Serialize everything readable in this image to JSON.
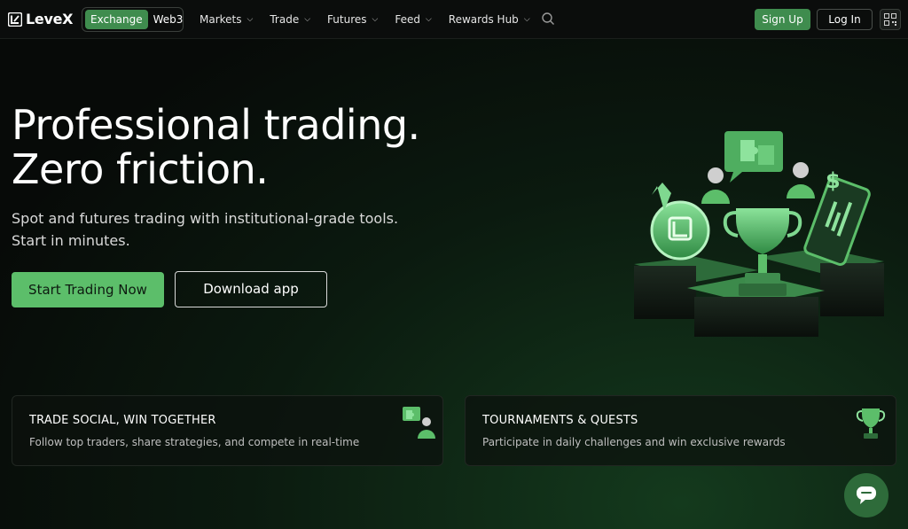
{
  "brand": {
    "name": "LeveX"
  },
  "mode_switch": {
    "options": [
      "Exchange",
      "Web3"
    ],
    "active": "Exchange"
  },
  "nav": {
    "items": [
      {
        "label": "Markets"
      },
      {
        "label": "Trade"
      },
      {
        "label": "Futures"
      },
      {
        "label": "Feed"
      },
      {
        "label": "Rewards Hub"
      }
    ]
  },
  "auth": {
    "signup_label": "Sign Up",
    "login_label": "Log In"
  },
  "hero": {
    "title_lines": [
      "Professional trading.",
      "Zero friction."
    ],
    "subtitle_lines": [
      "Spot and futures trading with institutional-grade tools.",
      "Start in minutes."
    ],
    "primary_cta": "Start Trading Now",
    "secondary_cta": "Download app"
  },
  "features": [
    {
      "title": "TRADE SOCIAL, WIN TOGETHER",
      "description": "Follow top traders, share strategies, and compete in real-time",
      "icon": "puzzle-people-icon"
    },
    {
      "title": "TOURNAMENTS & QUESTS",
      "description": "Participate in daily challenges and win exclusive rewards",
      "icon": "trophy-icon"
    }
  ],
  "icons": {
    "search": "search-icon",
    "qr": "qr-code-icon",
    "chat": "chat-icon",
    "chevron": "chevron-down-icon"
  },
  "colors": {
    "accent": "#5cbe6a",
    "accent_dark": "#3f8c4e",
    "background": "#070a08",
    "chat": "#2e6b3a"
  }
}
